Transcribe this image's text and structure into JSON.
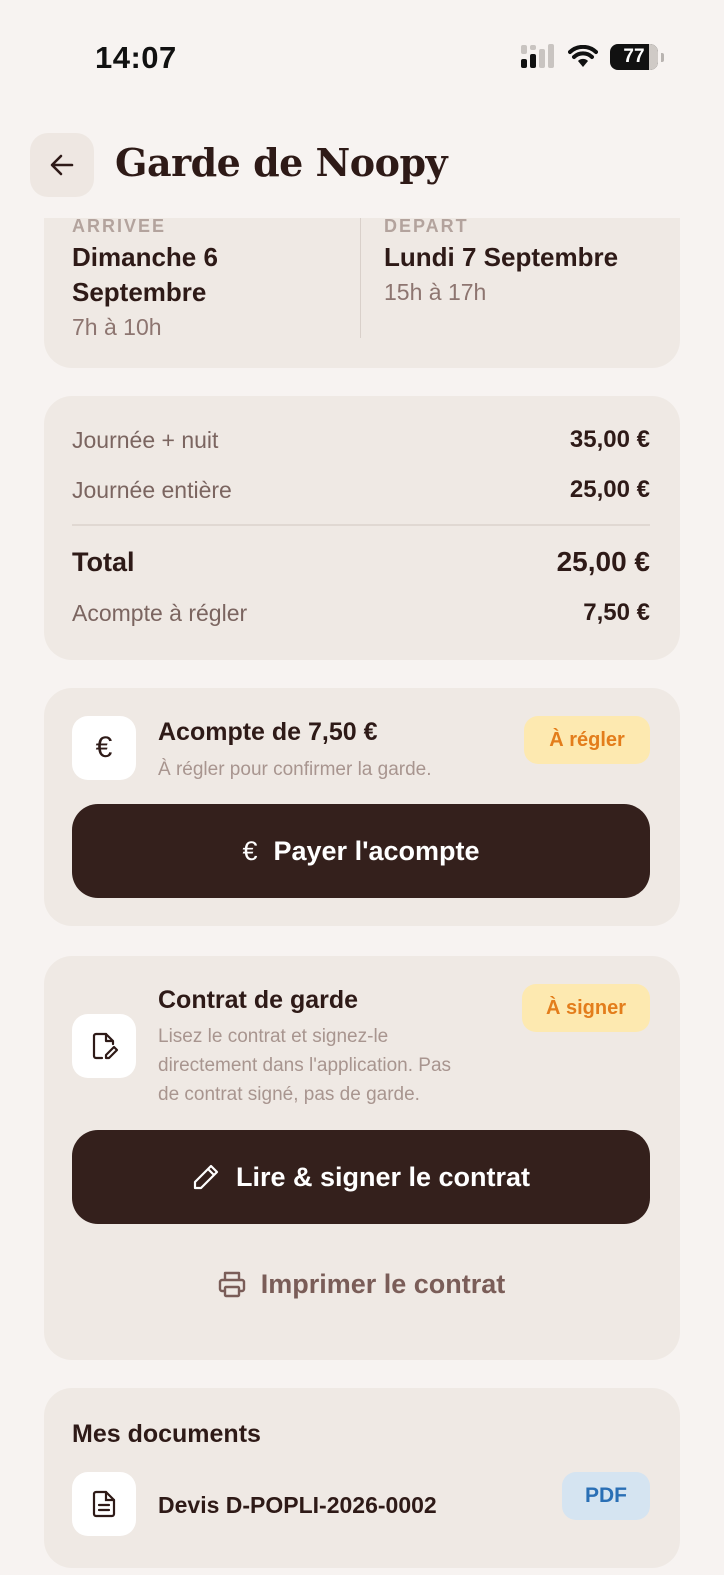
{
  "status_bar": {
    "time": "14:07",
    "battery": "77"
  },
  "header": {
    "title": "Garde de Noopy"
  },
  "dates": {
    "arrival": {
      "label": "ARRIVÉE",
      "date_line1": "Dimanche 6",
      "date_line2": "Septembre",
      "hours": "7h à 10h"
    },
    "departure": {
      "label": "DÉPART",
      "date": "Lundi 7 Septembre",
      "hours": "15h à 17h"
    }
  },
  "pricing": {
    "lines": [
      {
        "label": "Journée + nuit",
        "amount": "35,00 €"
      },
      {
        "label": "Journée entière",
        "amount": "25,00 €"
      }
    ],
    "total_label": "Total",
    "total_amount": "25,00 €",
    "deposit_label": "Acompte à régler",
    "deposit_amount": "7,50 €"
  },
  "deposit": {
    "icon_glyph": "€",
    "title": "Acompte de 7,50 €",
    "subtitle": "À régler pour confirmer la garde.",
    "badge": "À régler",
    "button_icon": "€",
    "button_label": "Payer l'acompte"
  },
  "contract": {
    "title": "Contrat de garde",
    "subtitle_line1": "Lisez le contrat et signez-le",
    "subtitle_line2": "directement dans l'application. Pas",
    "subtitle_line3": "de contrat signé, pas de garde.",
    "badge": "À signer",
    "sign_button": "Lire & signer le contrat",
    "print_button": "Imprimer le contrat"
  },
  "documents": {
    "title": "Mes documents",
    "items": [
      {
        "name": "Devis D-POPLI-2026-0002",
        "type": "PDF"
      }
    ]
  },
  "colors": {
    "background": "#f7f3f1",
    "card": "#efe9e4",
    "primary": "#34201c",
    "badge_warning_bg": "#fde9b0",
    "badge_warning_text": "#e37d1b",
    "badge_pdf_bg": "#d5e4f1",
    "badge_pdf_text": "#2a6fb5"
  }
}
